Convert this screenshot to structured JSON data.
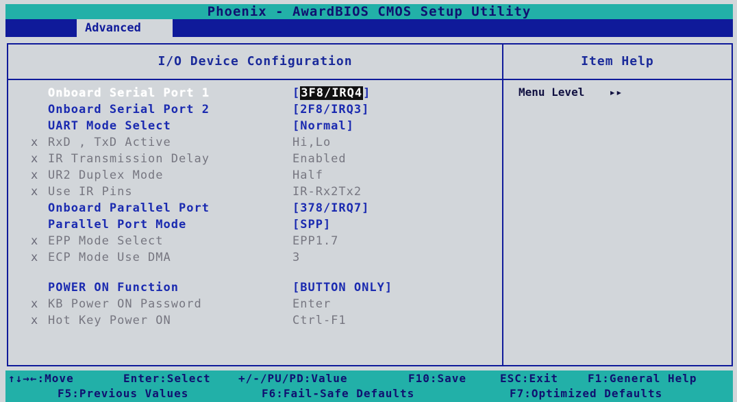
{
  "title": "Phoenix - AwardBIOS CMOS Setup Utility",
  "menu": {
    "active_tab": "Advanced"
  },
  "left_panel": {
    "header": "I/O Device Configuration",
    "rows": [
      {
        "mark": "",
        "label": "Onboard Serial Port 1",
        "value": "3F8/IRQ4",
        "bracketed": true,
        "state": "selected"
      },
      {
        "mark": "",
        "label": "Onboard Serial Port 2",
        "value": "[2F8/IRQ3]",
        "state": "active"
      },
      {
        "mark": "",
        "label": "UART Mode Select",
        "value": "[Normal]",
        "state": "active"
      },
      {
        "mark": "x",
        "label": "RxD , TxD Active",
        "value": "Hi,Lo",
        "state": "disabled"
      },
      {
        "mark": "x",
        "label": "IR Transmission Delay",
        "value": "Enabled",
        "state": "disabled"
      },
      {
        "mark": "x",
        "label": "UR2 Duplex Mode",
        "value": "Half",
        "state": "disabled"
      },
      {
        "mark": "x",
        "label": "Use IR Pins",
        "value": "IR-Rx2Tx2",
        "state": "disabled"
      },
      {
        "mark": "",
        "label": "Onboard Parallel Port",
        "value": "[378/IRQ7]",
        "state": "active"
      },
      {
        "mark": "",
        "label": "Parallel Port Mode",
        "value": "[SPP]",
        "state": "active"
      },
      {
        "mark": "x",
        "label": "EPP Mode Select",
        "value": "EPP1.7",
        "state": "disabled"
      },
      {
        "mark": "x",
        "label": "ECP Mode Use DMA",
        "value": "3",
        "state": "disabled"
      },
      {
        "mark": "",
        "label": "POWER ON Function",
        "value": "[BUTTON ONLY]",
        "state": "active"
      },
      {
        "mark": "x",
        "label": "KB Power ON Password",
        "value": "Enter",
        "state": "disabled"
      },
      {
        "mark": "x",
        "label": "Hot Key Power ON",
        "value": "Ctrl-F1",
        "state": "disabled"
      }
    ]
  },
  "right_panel": {
    "header": "Item Help",
    "menu_level_label": "Menu Level",
    "menu_level_arrow": "▸▸"
  },
  "keys": {
    "row1": {
      "move": "↑↓→←:Move",
      "select": "Enter:Select",
      "value": "+/-/PU/PD:Value",
      "save": "F10:Save",
      "exit": "ESC:Exit",
      "help": "F1:General Help"
    },
    "row2": {
      "previous": "F5:Previous Values",
      "failsafe": "F6:Fail-Safe Defaults",
      "optimized": "F7:Optimized Defaults"
    }
  },
  "colors": {
    "background": "#d2d6da",
    "title_bar": "#22b0a8",
    "menu_bar": "#0f1a9a",
    "active_text": "#1a2ab0",
    "disabled_text": "#767680"
  }
}
